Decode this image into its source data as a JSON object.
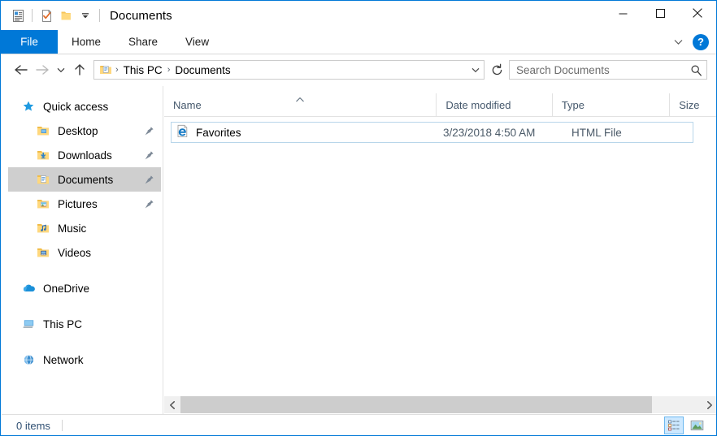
{
  "window": {
    "title": "Documents",
    "quick_access_toolbar": [
      {
        "name": "properties-icon",
        "label": "Properties"
      },
      {
        "name": "new-folder-checkmark-icon",
        "label": "New folder"
      },
      {
        "name": "folder-icon",
        "label": "Folder"
      },
      {
        "name": "customize-chevron-icon",
        "label": "Customize Quick Access Toolbar"
      }
    ],
    "controls": {
      "minimize": "Minimize",
      "maximize": "Maximize",
      "close": "Close"
    }
  },
  "ribbon": {
    "tabs": [
      {
        "label": "File",
        "active": true
      },
      {
        "label": "Home",
        "active": false
      },
      {
        "label": "Share",
        "active": false
      },
      {
        "label": "View",
        "active": false
      }
    ],
    "collapse_label": "Minimize the Ribbon",
    "help_label": "?"
  },
  "address": {
    "back_label": "Back",
    "forward_label": "Forward",
    "recent_label": "Recent locations",
    "up_label": "Up",
    "breadcrumbs": [
      "This PC",
      "Documents"
    ],
    "separator": "›",
    "refresh_label": "Refresh"
  },
  "search": {
    "placeholder": "Search Documents",
    "value": ""
  },
  "sidebar": {
    "items": [
      {
        "label": "Quick access",
        "icon": "star-icon",
        "indent": 0,
        "pinned": false,
        "selected": false
      },
      {
        "label": "Desktop",
        "icon": "folder-desktop-icon",
        "indent": 1,
        "pinned": true,
        "selected": false
      },
      {
        "label": "Downloads",
        "icon": "folder-downloads-icon",
        "indent": 1,
        "pinned": true,
        "selected": false
      },
      {
        "label": "Documents",
        "icon": "folder-documents-icon",
        "indent": 1,
        "pinned": true,
        "selected": true
      },
      {
        "label": "Pictures",
        "icon": "folder-pictures-icon",
        "indent": 1,
        "pinned": true,
        "selected": false
      },
      {
        "label": "Music",
        "icon": "folder-music-icon",
        "indent": 1,
        "pinned": false,
        "selected": false
      },
      {
        "label": "Videos",
        "icon": "folder-videos-icon",
        "indent": 1,
        "pinned": false,
        "selected": false
      },
      {
        "label": "OneDrive",
        "icon": "onedrive-cloud-icon",
        "indent": 0,
        "pinned": false,
        "selected": false
      },
      {
        "label": "This PC",
        "icon": "this-pc-monitor-icon",
        "indent": 0,
        "pinned": false,
        "selected": false
      },
      {
        "label": "Network",
        "icon": "network-globe-icon",
        "indent": 0,
        "pinned": false,
        "selected": false
      }
    ]
  },
  "filelist": {
    "columns": [
      {
        "label": "Name",
        "sorted": true,
        "sort_direction": "ascending"
      },
      {
        "label": "Date modified",
        "sorted": false
      },
      {
        "label": "Type",
        "sorted": false
      },
      {
        "label": "Size",
        "sorted": false
      }
    ],
    "rows": [
      {
        "name": "Favorites",
        "date_modified": "3/23/2018 4:50 AM",
        "type": "HTML File",
        "size": "",
        "icon": "ie-html-file-icon"
      }
    ]
  },
  "statusbar": {
    "item_count": "0 items",
    "view_details_label": "Details view",
    "view_large_icons_label": "Large icons view",
    "active_view": "details"
  },
  "colors": {
    "accent": "#0078d7",
    "selection": "#cfcfcf",
    "row_border": "#b8d6ea",
    "header_text": "#45586c",
    "status_text": "#2f4f72",
    "folder_yellow": "#ffd175"
  }
}
